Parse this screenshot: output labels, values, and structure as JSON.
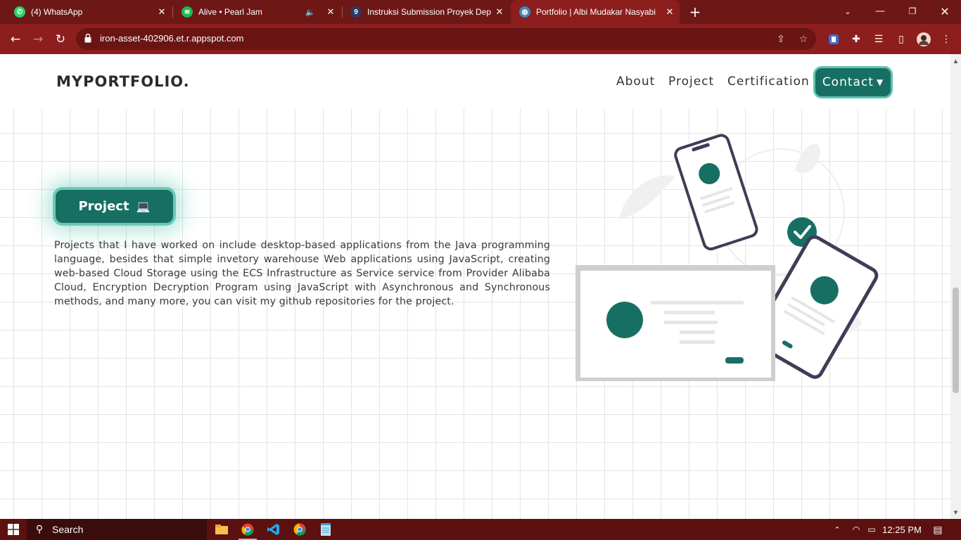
{
  "browser": {
    "tabs": [
      {
        "title": "(4) WhatsApp",
        "icon": "whatsapp-icon",
        "color": "#25d366"
      },
      {
        "title": "Alive • Pearl Jam",
        "icon": "spotify-icon",
        "color": "#1db954",
        "audio": true
      },
      {
        "title": "Instruksi Submission Proyek Dep",
        "icon": "site-favicon",
        "color": "#2b3a67"
      },
      {
        "title": "Portfolio | Albi Mudakar Nasyabi",
        "icon": "globe-icon",
        "color": "#3e8ab8",
        "active": true
      }
    ],
    "url": "iron-asset-402906.et.r.appspot.com"
  },
  "site": {
    "brand": "MYPORTFOLIO.",
    "nav": {
      "about": "About",
      "project": "Project",
      "certification": "Certification",
      "contact": "Contact"
    },
    "section": {
      "title": "Project",
      "title_icon": "💻",
      "description": "Projects that I have worked on include desktop-based applications from the Java programming language, besides that simple invetory warehouse Web applications using JavaScript, creating web-based Cloud Storage using the ECS Infrastructure as Service service from Provider Alibaba Cloud, Encryption Decryption Program using JavaScript with Asynchronous and Synchronous methods, and many more, you can visit my github repositories for the project."
    },
    "colors": {
      "accent": "#176f63",
      "accent_border": "#6cc9b7",
      "chrome": "#8c1e1e"
    }
  },
  "taskbar": {
    "search_placeholder": "Search",
    "time": "12:25 PM"
  }
}
